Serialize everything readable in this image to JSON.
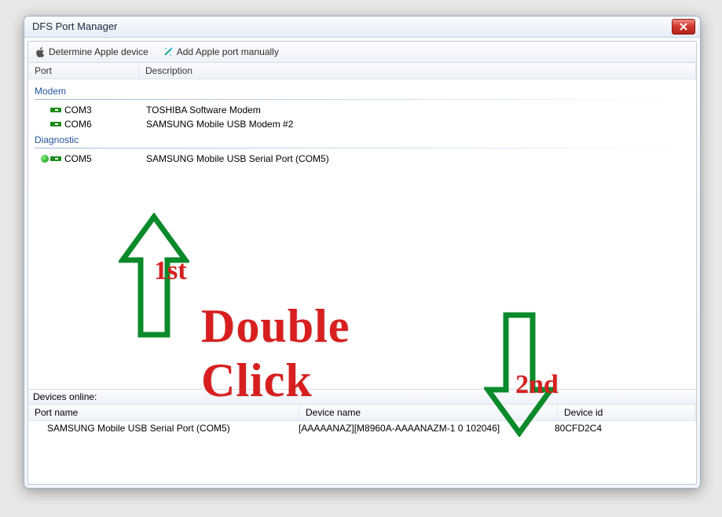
{
  "window": {
    "title": "DFS Port Manager"
  },
  "toolbar": {
    "determine_label": "Determine Apple device",
    "add_label": "Add Apple port manually"
  },
  "tree": {
    "headers": {
      "port": "Port",
      "desc": "Description"
    },
    "groups": [
      {
        "label": "Modem",
        "items": [
          {
            "port": "COM3",
            "desc": "TOSHIBA Software Modem",
            "selected": false
          },
          {
            "port": "COM6",
            "desc": "SAMSUNG Mobile USB Modem #2",
            "selected": false
          }
        ]
      },
      {
        "label": "Diagnostic",
        "items": [
          {
            "port": "COM5",
            "desc": "SAMSUNG Mobile USB Serial Port  (COM5)",
            "selected": true
          }
        ]
      }
    ]
  },
  "devices": {
    "title": "Devices online:",
    "headers": {
      "port": "Port name",
      "name": "Device name",
      "id": "Device id"
    },
    "rows": [
      {
        "port": "SAMSUNG Mobile USB Serial Port  (COM5)",
        "name": "[AAAAANAZ][M8960A-AAAANAZM-1 0 102046]",
        "id": "80CFD2C4"
      }
    ]
  },
  "annot": {
    "main": "Double Click",
    "first": "1st",
    "second": "2nd"
  }
}
